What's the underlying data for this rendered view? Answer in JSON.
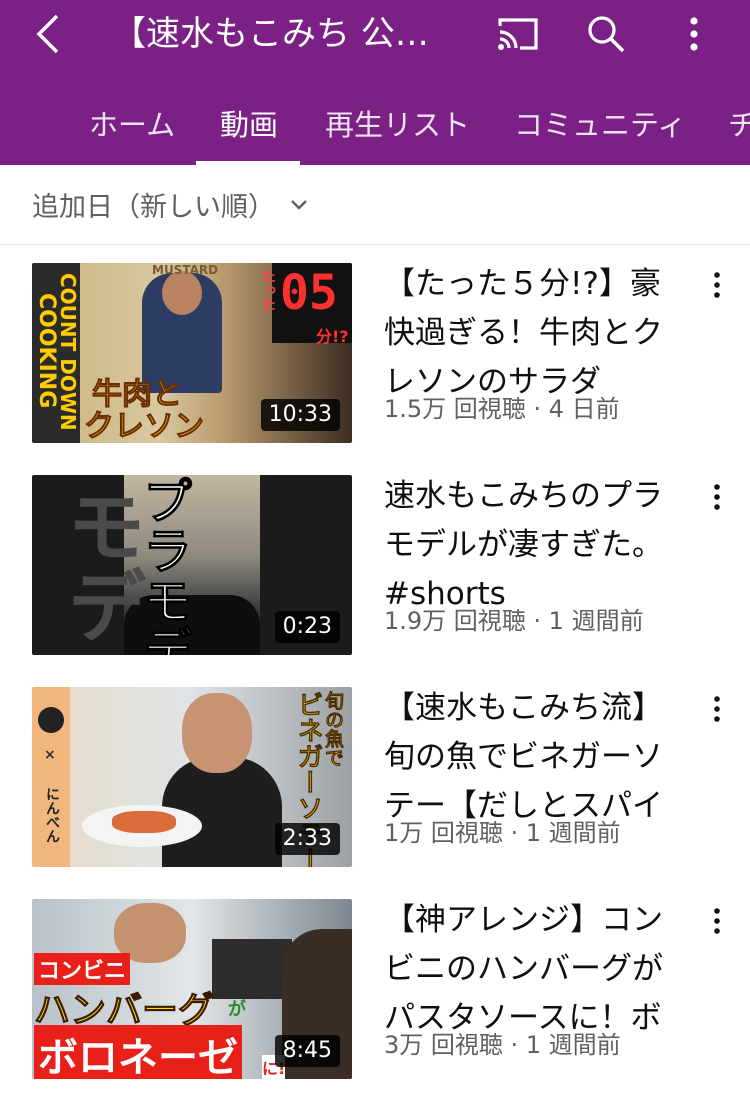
{
  "header": {
    "title": "【速水もこみち 公式】",
    "back_icon": "chevron-left-icon",
    "cast_icon": "cast-icon",
    "search_icon": "search-icon",
    "more_icon": "more-vertical-icon"
  },
  "tabs": [
    {
      "label": "ホーム",
      "active": false
    },
    {
      "label": "動画",
      "active": true
    },
    {
      "label": "再生リスト",
      "active": false
    },
    {
      "label": "コミュニティ",
      "active": false
    },
    {
      "label": "チャンネル",
      "active": false
    }
  ],
  "sort": {
    "label": "追加日（新しい順）",
    "icon": "chevron-down-icon"
  },
  "videos": [
    {
      "title": "【たった５分!?】豪快過ぎる！牛肉とクレソンのサラダ",
      "meta": "1.5万 回視聴 · 4 日前",
      "duration": "10:33",
      "overlay": [
        "COUNT DOWN",
        "COOKING",
        "牛肉と",
        "クレソン",
        "たった",
        "05",
        "分!?",
        "MUSTARD"
      ]
    },
    {
      "title": "速水もこみちのプラモデルが凄すぎた。#shorts",
      "meta": "1.9万 回視聴 · 1 週間前",
      "duration": "0:23",
      "overlay": [
        "モデ",
        "プラモデルです"
      ]
    },
    {
      "title": "【速水もこみち流】旬の魚でビネガーソテー【だしとスパイス】",
      "meta": "1万 回視聴 · 1 週間前",
      "duration": "2:33",
      "overlay": [
        "旬の魚で",
        "ビネガーソテー",
        "×",
        "にんべん"
      ]
    },
    {
      "title": "【神アレンジ】コンビニのハンバーグがパスタソースに！ボロネーゼ",
      "meta": "3万 回視聴 · 1 週間前",
      "duration": "8:45",
      "overlay": [
        "コンビニ",
        "ハンバーグ",
        "が",
        "ボロネーゼ",
        "に!"
      ]
    }
  ],
  "colors": {
    "app_bar": "#7b2186",
    "meta_text": "#606060"
  }
}
